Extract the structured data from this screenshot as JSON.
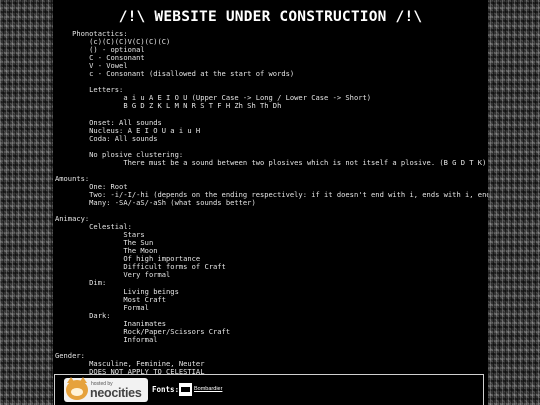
{
  "page": {
    "title": "/!\\ WEBSITE UNDER CONSTRUCTION /!\\"
  },
  "content_lines": [
    "    Phonotactics:",
    "        (c)(C)(C)V(C)(C)(C)",
    "        () - optional",
    "        C - Consonant",
    "        V - Vowel",
    "        c - Consonant (disallowed at the start of words)",
    "",
    "        Letters:",
    "                a i u A E I O U (Upper Case -> Long / Lower Case -> Short)",
    "                B G D Z K L M N R S T F H Zh Sh Th Dh",
    "",
    "        Onset: All sounds",
    "        Nucleus: A E I O U a i u H",
    "        Coda: All sounds",
    "",
    "        No plosive clustering:",
    "                There must be a sound between two plosives which is not itself a plosive. (B G D T K)",
    "",
    "Amounts:",
    "        One: Root",
    "        Two: -i/-I/-hi (depends on the ending respectively: if it doesn't end with i, ends with i, ends with I)",
    "        Many: -SA/-aS/-aSh (what sounds better)",
    "",
    "Animacy:",
    "        Celestial:",
    "                Stars",
    "                The Sun",
    "                The Moon",
    "                Of high importance",
    "                Difficult forms of Craft",
    "                Very formal",
    "        Dim:",
    "                Living beings",
    "                Most Craft",
    "                Formal",
    "        Dark:",
    "                Inanimates",
    "                Rock/Paper/Scissors Craft",
    "                Informal",
    "",
    "Gender:",
    "        Masculine, Feminine, Neuter",
    "        DOES NOT APPLY TO CELESTIAL"
  ],
  "footer": {
    "hosted_by": "hosted by",
    "neocities": "neocities",
    "fonts_label": "Fonts:",
    "font_name": "Bombardier",
    "badge_icon": "neocities-cat-icon",
    "font_icon": "font-logo-icon"
  }
}
